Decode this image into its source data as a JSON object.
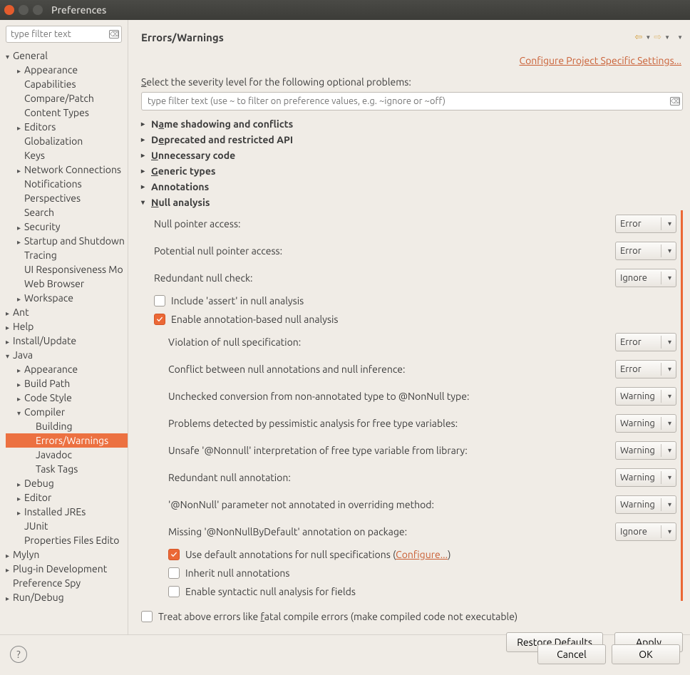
{
  "window": {
    "title": "Preferences"
  },
  "sidebar": {
    "filter_placeholder": "type filter text",
    "tree": [
      {
        "label": "General",
        "level": 0,
        "expanded": true,
        "hasChildren": true
      },
      {
        "label": "Appearance",
        "level": 1,
        "hasChildren": true
      },
      {
        "label": "Capabilities",
        "level": 1
      },
      {
        "label": "Compare/Patch",
        "level": 1
      },
      {
        "label": "Content Types",
        "level": 1
      },
      {
        "label": "Editors",
        "level": 1,
        "hasChildren": true
      },
      {
        "label": "Globalization",
        "level": 1
      },
      {
        "label": "Keys",
        "level": 1
      },
      {
        "label": "Network Connections",
        "level": 1,
        "hasChildren": true
      },
      {
        "label": "Notifications",
        "level": 1
      },
      {
        "label": "Perspectives",
        "level": 1
      },
      {
        "label": "Search",
        "level": 1
      },
      {
        "label": "Security",
        "level": 1,
        "hasChildren": true
      },
      {
        "label": "Startup and Shutdown",
        "level": 1,
        "hasChildren": true
      },
      {
        "label": "Tracing",
        "level": 1
      },
      {
        "label": "UI Responsiveness Mo",
        "level": 1
      },
      {
        "label": "Web Browser",
        "level": 1
      },
      {
        "label": "Workspace",
        "level": 1,
        "hasChildren": true
      },
      {
        "label": "Ant",
        "level": 0,
        "hasChildren": true
      },
      {
        "label": "Help",
        "level": 0,
        "hasChildren": true
      },
      {
        "label": "Install/Update",
        "level": 0,
        "hasChildren": true
      },
      {
        "label": "Java",
        "level": 0,
        "expanded": true,
        "hasChildren": true
      },
      {
        "label": "Appearance",
        "level": 1,
        "hasChildren": true
      },
      {
        "label": "Build Path",
        "level": 1,
        "hasChildren": true
      },
      {
        "label": "Code Style",
        "level": 1,
        "hasChildren": true
      },
      {
        "label": "Compiler",
        "level": 1,
        "expanded": true,
        "hasChildren": true
      },
      {
        "label": "Building",
        "level": 2
      },
      {
        "label": "Errors/Warnings",
        "level": 2,
        "selected": true
      },
      {
        "label": "Javadoc",
        "level": 2
      },
      {
        "label": "Task Tags",
        "level": 2
      },
      {
        "label": "Debug",
        "level": 1,
        "hasChildren": true
      },
      {
        "label": "Editor",
        "level": 1,
        "hasChildren": true
      },
      {
        "label": "Installed JREs",
        "level": 1,
        "hasChildren": true
      },
      {
        "label": "JUnit",
        "level": 1
      },
      {
        "label": "Properties Files Edito",
        "level": 1
      },
      {
        "label": "Mylyn",
        "level": 0,
        "hasChildren": true
      },
      {
        "label": "Plug-in Development",
        "level": 0,
        "hasChildren": true
      },
      {
        "label": "Preference Spy",
        "level": 0
      },
      {
        "label": "Run/Debug",
        "level": 0,
        "hasChildren": true
      }
    ]
  },
  "page": {
    "title": "Errors/Warnings",
    "project_link": "Configure Project Specific Settings...",
    "instruction_pre": "S",
    "instruction_post": "elect the severity level for the following optional problems:",
    "filter_placeholder": "type filter text (use ~ to filter on preference values, e.g. ~ignore or ~off)",
    "sections": {
      "name_shadowing": "Name shadowing and conflicts",
      "deprecated": "Deprecated and restricted API",
      "unnecessary": "Unnecessary code",
      "generic": "Generic types",
      "annotations": "Annotations",
      "null": "Null analysis"
    },
    "null_analysis": {
      "null_pointer": {
        "label": "Null pointer access:",
        "value": "Error"
      },
      "potential_null": {
        "label": "Potential null pointer access:",
        "value": "Error"
      },
      "redundant_check": {
        "label": "Redundant null check:",
        "value": "Ignore"
      },
      "include_assert": {
        "label": "Include 'assert' in null analysis",
        "checked": false
      },
      "enable_annotation": {
        "label": "Enable annotation-based null analysis",
        "checked": true
      },
      "sub": {
        "violation": {
          "label": "Violation of null specification:",
          "value": "Error"
        },
        "conflict": {
          "label": "Conflict between null annotations and null inference:",
          "value": "Error"
        },
        "unchecked": {
          "label": "Unchecked conversion from non-annotated type to @NonNull type:",
          "value": "Warning"
        },
        "pessimistic": {
          "label": "Problems detected by pessimistic analysis for free type variables:",
          "value": "Warning"
        },
        "unsafe": {
          "label": "Unsafe '@Nonnull' interpretation of free type variable from library:",
          "value": "Warning"
        },
        "redundant_ann": {
          "label": "Redundant null annotation:",
          "value": "Warning"
        },
        "nonnull_param": {
          "label": "'@NonNull' parameter not annotated in overriding method:",
          "value": "Warning"
        },
        "missing_default": {
          "label": "Missing '@NonNullByDefault' annotation on package:",
          "value": "Ignore"
        },
        "use_default_pre": "Use default annotations for null specifications (",
        "use_default_link": "Configure...",
        "use_default_post": ")",
        "use_default_checked": true,
        "inherit": {
          "label": "Inherit null annotations",
          "checked": false
        },
        "syntactic": {
          "label": "Enable syntactic null analysis for fields",
          "checked": false
        }
      }
    },
    "treat_fatal_pre": "Treat above errors like ",
    "treat_fatal_u": "f",
    "treat_fatal_post": "atal compile errors (make compiled code not executable)",
    "restore_defaults": "Restore Defaults",
    "apply": "Apply"
  },
  "footer": {
    "cancel": "Cancel",
    "ok": "OK"
  }
}
